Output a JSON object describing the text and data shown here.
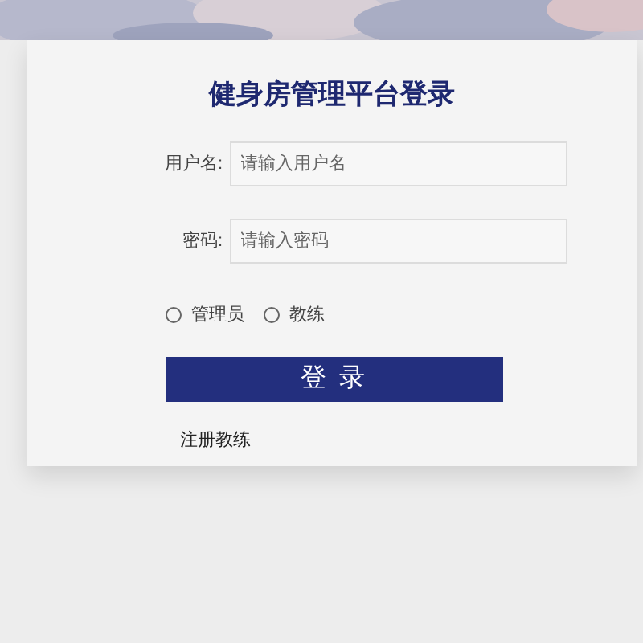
{
  "title": "健身房管理平台登录",
  "fields": [
    {
      "label": "用户名:",
      "placeholder": "请输入用户名"
    },
    {
      "label": "密码:",
      "placeholder": "请输入密码"
    }
  ],
  "roles": [
    {
      "label": "管理员",
      "selected": false
    },
    {
      "label": "教练",
      "selected": false
    }
  ],
  "login_button": "登 录",
  "register_link": "注册教练"
}
